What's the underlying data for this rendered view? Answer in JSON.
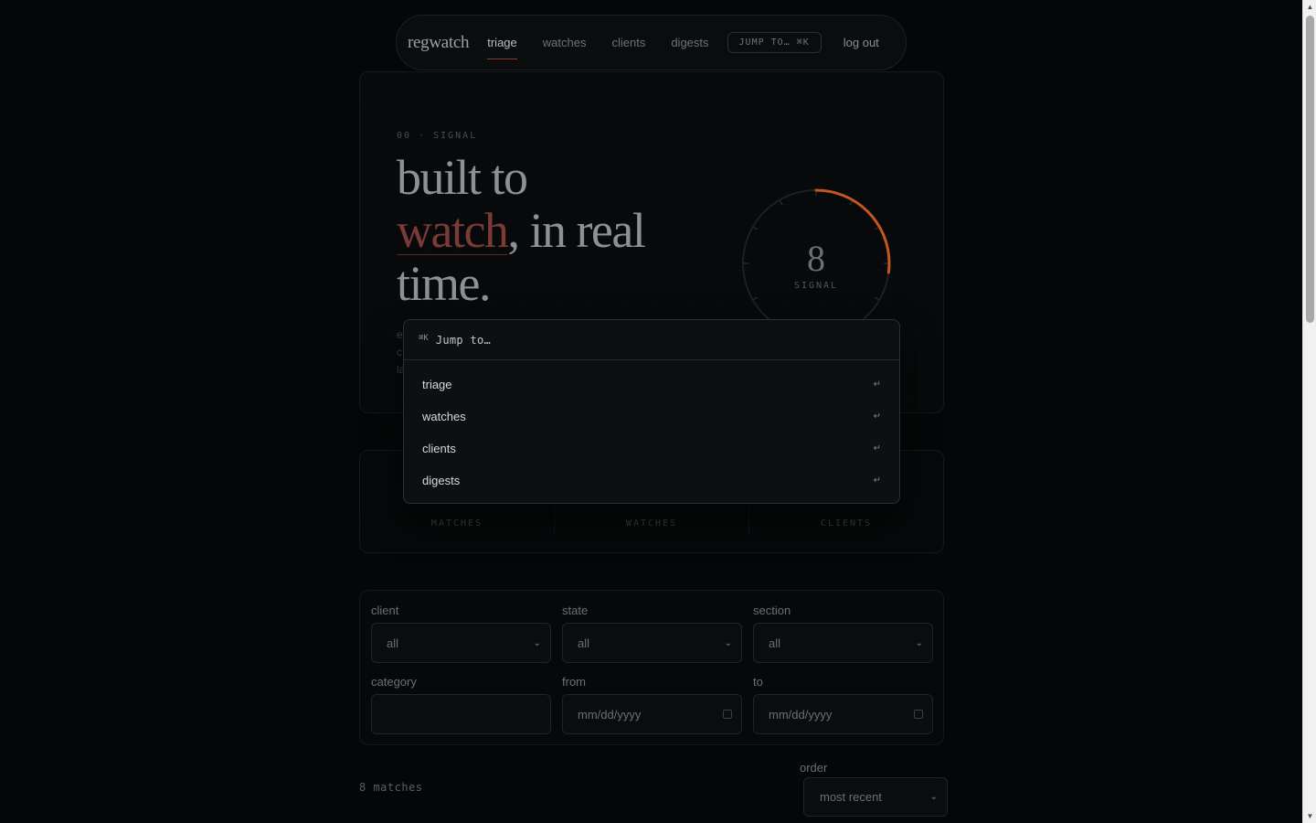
{
  "nav": {
    "brand": "regwatch",
    "links": [
      {
        "label": "triage",
        "active": true
      },
      {
        "label": "watches",
        "active": false
      },
      {
        "label": "clients",
        "active": false
      },
      {
        "label": "digests",
        "active": false
      }
    ],
    "jump_label": "JUMP TO… ⌘K",
    "logout_label": "log out"
  },
  "hero": {
    "eyebrow": "00 · SIGNAL",
    "headline_line1": "built to",
    "headline_accent": "watch",
    "headline_line2_rest": ", in real",
    "headline_line3": "time.",
    "tail_fragments": [
      "e",
      "c",
      "la"
    ],
    "gauge": {
      "value": "8",
      "label": "SIGNAL",
      "fill_fraction": 0.27,
      "accent_color": "#c2571f"
    }
  },
  "stats": [
    {
      "label": "MATCHES"
    },
    {
      "label": "WATCHES"
    },
    {
      "label": "CLIENTS"
    }
  ],
  "filters": {
    "client": {
      "label": "client",
      "value": "all"
    },
    "state": {
      "label": "state",
      "value": "all"
    },
    "section": {
      "label": "section",
      "value": "all"
    },
    "category": {
      "label": "category",
      "value": ""
    },
    "from": {
      "label": "from",
      "placeholder": "mm/dd/yyyy"
    },
    "to": {
      "label": "to",
      "placeholder": "mm/dd/yyyy"
    }
  },
  "results": {
    "count_text": "8 matches",
    "order_label": "order",
    "order_value": "most recent"
  },
  "palette": {
    "kbd": "⌘K",
    "input_text": "Jump to…",
    "items": [
      {
        "label": "triage",
        "hint": "↵"
      },
      {
        "label": "watches",
        "hint": "↵"
      },
      {
        "label": "clients",
        "hint": "↵"
      },
      {
        "label": "digests",
        "hint": "↵"
      }
    ]
  }
}
